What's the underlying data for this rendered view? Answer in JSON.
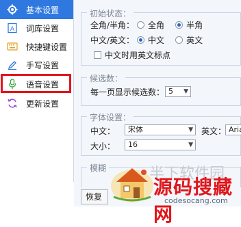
{
  "sidebar": {
    "items": [
      {
        "label": "基本设置",
        "icon": "gear-icon",
        "active": true
      },
      {
        "label": "词库设置",
        "icon": "dictionary-icon",
        "active": false
      },
      {
        "label": "快捷键设置",
        "icon": "keyboard-icon",
        "active": false
      },
      {
        "label": "手写设置",
        "icon": "pen-icon",
        "active": false
      },
      {
        "label": "语音设置",
        "icon": "microphone-icon",
        "active": false
      },
      {
        "label": "更新设置",
        "icon": "refresh-icon",
        "active": false
      }
    ]
  },
  "initial_state": {
    "title": "初始状态：",
    "width_label": "全角/半角：",
    "full_width": "全角",
    "half_width": "半角",
    "lang_label": "中文/英文：",
    "chinese": "中文",
    "english": "英文",
    "punct_checkbox": "中文时用英文标点"
  },
  "candidates": {
    "title": "候选数：",
    "per_page_label": "每一页显示候选数：",
    "per_page_value": "5"
  },
  "font": {
    "title": "字体设置：",
    "chinese_label": "中文：",
    "chinese_value": "宋体",
    "english_label": "英文：",
    "english_value": "Arial",
    "size_label": "大小：",
    "size_value": "16"
  },
  "partial_group_title": "模糊",
  "restore_button": "恢复",
  "watermark": {
    "main_text": "源码搜藏网",
    "url_text": "codesocang.com",
    "faint_text": "半下软件园"
  },
  "colors": {
    "active_bg": "#2f78e0",
    "highlight_border": "#e3141a",
    "watermark_red": "#e0161b"
  }
}
